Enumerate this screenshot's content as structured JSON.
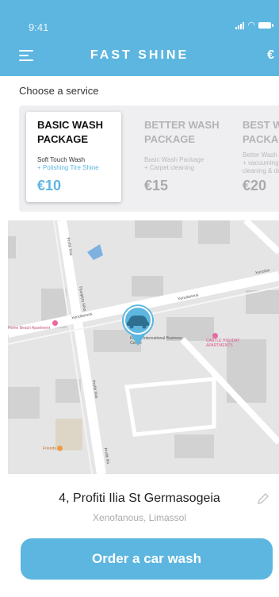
{
  "status_bar": {
    "time": "9:41"
  },
  "header": {
    "title": "FAST SHINE",
    "currency_symbol": "€"
  },
  "service": {
    "prompt": "Choose a service",
    "packages": [
      {
        "name": "BASIC WASH PACKAGE",
        "desc": "Soft Touch Wash",
        "extra": "+ Polishing Tire Shine",
        "price": "€10",
        "selected": true
      },
      {
        "name": "BETTER WASH PACKAGE",
        "desc": "Basic Wash Package",
        "extra": "+ Carpet cleaning",
        "price": "€15",
        "selected": false
      },
      {
        "name": "BEST WA PACKAG",
        "desc": "Better Wash P",
        "extra": "+ vacuuming cleaning & da",
        "price": "€20",
        "selected": false
      }
    ]
  },
  "map": {
    "labels": {
      "street1": "Profiti Ilias",
      "street2": "Προφήτη Ηλία",
      "street3": "Xenofanous",
      "street4": "Xenofanous",
      "street5": "Xenofon",
      "street6": "Profiti Ilias",
      "street7": "Profiti Ilia",
      "poi1": "Home Beach Apartment",
      "poi2": "Kanika International Business Center",
      "poi3": "CASTLE HOLIDAY APARTMENTS",
      "poi4": "Friends"
    },
    "pin_icon": "car-icon"
  },
  "address": {
    "street": "4, Profiti Ilia St Germasogeia",
    "area": "Xenofanous, Limassol"
  },
  "actions": {
    "order_label": "Order a car wash"
  },
  "colors": {
    "primary": "#5db6e0",
    "muted": "#efeff1"
  }
}
